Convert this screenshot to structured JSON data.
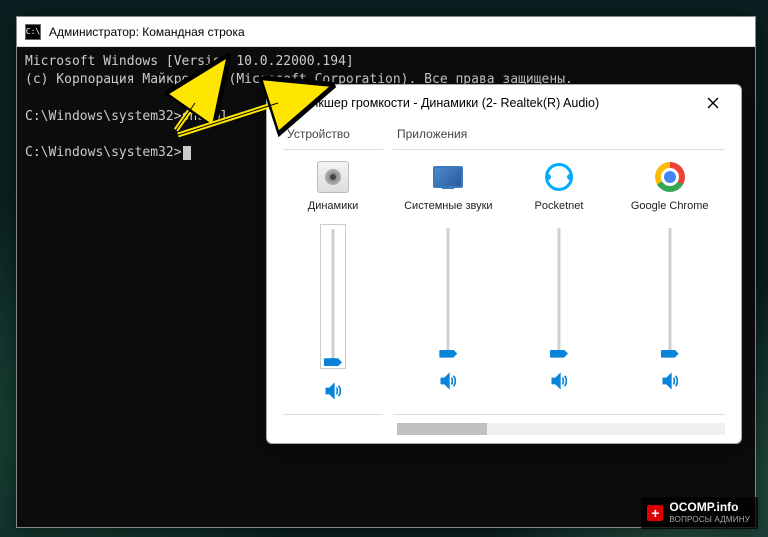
{
  "cmd": {
    "title": "Администратор: Командная строка",
    "line1": "Microsoft Windows [Version 10.0.22000.194]",
    "line2": "(c) Корпорация Майкрософт (Microsoft Corporation). Все права защищены.",
    "prompt1_path": "C:\\Windows\\system32>",
    "prompt1_cmd": "sndvol",
    "prompt2_path": "C:\\Windows\\system32>"
  },
  "mixer": {
    "title": "Микшер громкости - Динамики (2- Realtek(R) Audio)",
    "section_device": "Устройство",
    "section_apps": "Приложения",
    "device": {
      "label": "Динамики",
      "level_pct": 4
    },
    "apps": [
      {
        "label": "Системные звуки",
        "icon": "monitor-icon",
        "level_pct": 4
      },
      {
        "label": "Pocketnet",
        "icon": "pocketnet-icon",
        "level_pct": 4
      },
      {
        "label": "Google Chrome",
        "icon": "chrome-icon",
        "level_pct": 4
      }
    ]
  },
  "watermark": {
    "brand": "OCOMP.info",
    "tagline": "ВОПРОСЫ АДМИНУ"
  }
}
